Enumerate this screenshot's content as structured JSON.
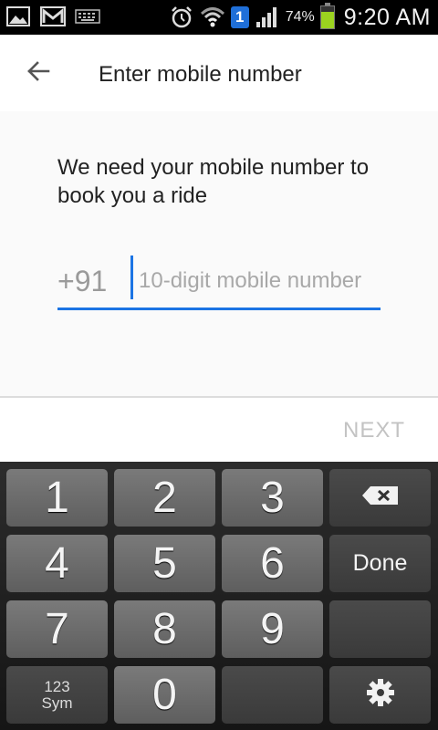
{
  "status_bar": {
    "notification_badge": "1",
    "battery_percent": "74%",
    "battery_level": 0.74,
    "time": "9:20 AM",
    "icons": [
      "gallery-icon",
      "gmail-icon",
      "keyboard-icon",
      "alarm-icon",
      "wifi-icon",
      "signal-icon",
      "battery-icon"
    ]
  },
  "app_bar": {
    "title": "Enter mobile number",
    "back_icon": "arrow-back-icon"
  },
  "form": {
    "prompt": "We need your mobile number to book you a ride",
    "country_code": "+91",
    "phone_placeholder": "10-digit mobile number",
    "phone_value": ""
  },
  "footer": {
    "next_label": "NEXT"
  },
  "keyboard": {
    "keys": {
      "k1": "1",
      "k2": "2",
      "k3": "3",
      "k4": "4",
      "k5": "5",
      "k6": "6",
      "k7": "7",
      "k8": "8",
      "k9": "9",
      "k0": "0",
      "done": "Done",
      "sym_top": "123",
      "sym_bottom": "Sym"
    },
    "backspace_icon": "backspace-icon",
    "settings_icon": "gear-icon"
  },
  "colors": {
    "accent": "#1b74e4",
    "next_disabled": "#c3c3c3",
    "battery": "#9bd31f"
  }
}
